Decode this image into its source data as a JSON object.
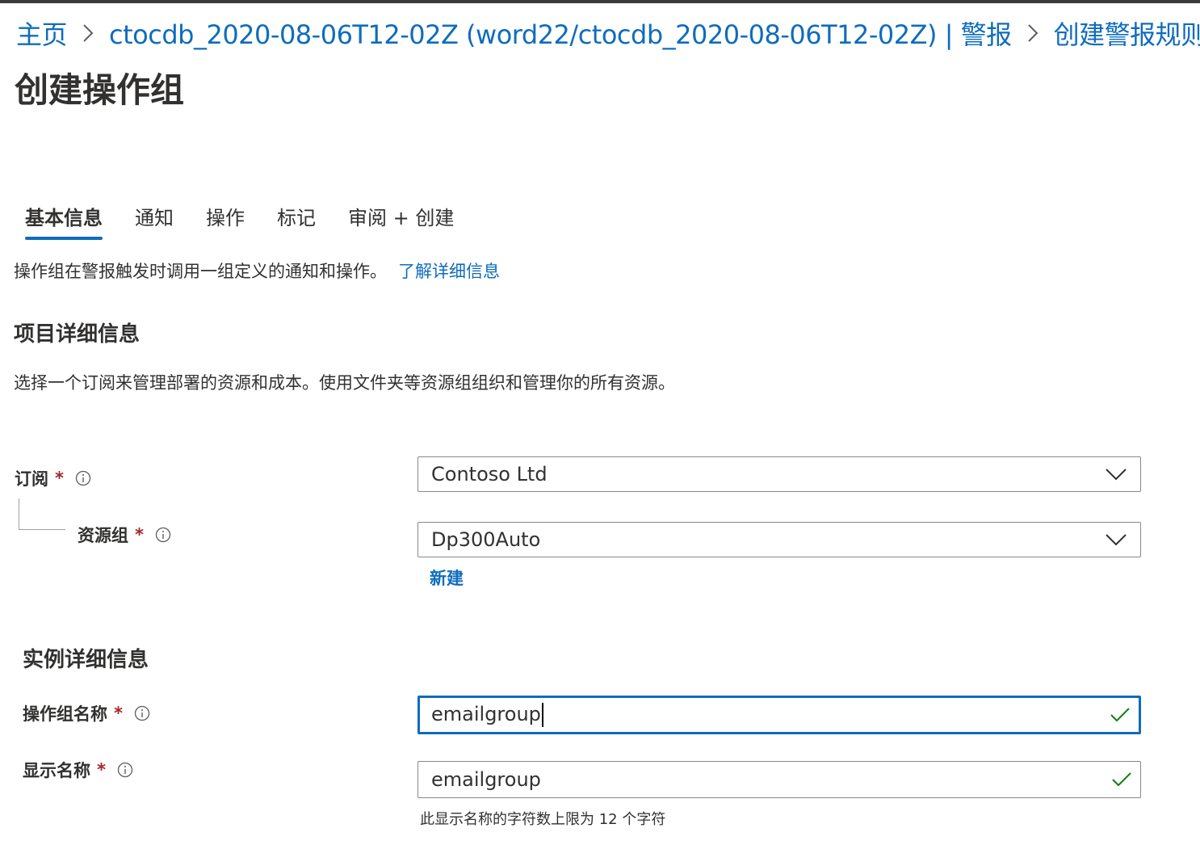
{
  "breadcrumb": {
    "items": [
      "主页",
      "ctocdb_2020-08-06T12-02Z (word22/ctocdb_2020-08-06T12-02Z) | 警报",
      "创建警报规则"
    ]
  },
  "page": {
    "title": "创建操作组"
  },
  "tabs": [
    {
      "label": "基本信息",
      "active": true
    },
    {
      "label": "通知"
    },
    {
      "label": "操作"
    },
    {
      "label": "标记"
    },
    {
      "label": "审阅 + 创建"
    }
  ],
  "intro": {
    "text": "操作组在警报触发时调用一组定义的通知和操作。",
    "link": "了解详细信息"
  },
  "project": {
    "title": "项目详细信息",
    "description": "选择一个订阅来管理部署的资源和成本。使用文件夹等资源组组织和管理你的所有资源。",
    "subscription": {
      "label": "订阅",
      "value": "Contoso Ltd"
    },
    "resource_group": {
      "label": "资源组",
      "value": "Dp300Auto",
      "new_link": "新建"
    }
  },
  "instance": {
    "title": "实例详细信息",
    "action_group_name": {
      "label": "操作组名称",
      "value": "emailgroup"
    },
    "display_name": {
      "label": "显示名称",
      "value": "emailgroup",
      "hint": "此显示名称的字符数上限为 12 个字符"
    }
  },
  "required_marker": "*",
  "colors": {
    "accent": "#0f6cbd",
    "required": "#a4262c",
    "valid": "#107c10"
  }
}
